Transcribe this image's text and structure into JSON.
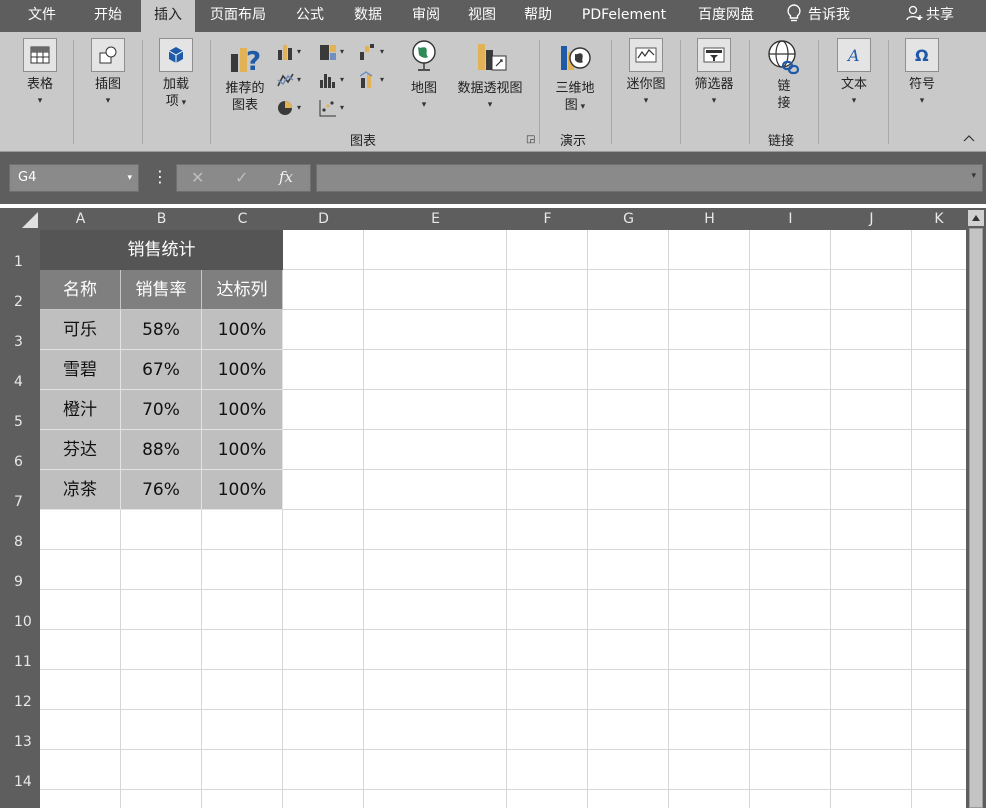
{
  "menubar": {
    "tabs": [
      "文件",
      "开始",
      "插入",
      "页面布局",
      "公式",
      "数据",
      "审阅",
      "视图",
      "帮助",
      "PDFelement",
      "百度网盘"
    ],
    "active_tab": "插入",
    "tell_me": "告诉我",
    "share": "共享"
  },
  "ribbon": {
    "table": "表格",
    "illustrations": "插图",
    "addins_line1": "加载",
    "addins_line2": "项",
    "recommended_line1": "推荐的",
    "recommended_line2": "图表",
    "maps": "地图",
    "pivotchart": "数据透视图",
    "map3d_line1": "三维地",
    "map3d_line2": "图",
    "sparklines": "迷你图",
    "filters": "筛选器",
    "link_line1": "链",
    "link_line2": "接",
    "text": "文本",
    "symbols": "符号",
    "group_charts": "图表",
    "group_tours": "演示",
    "group_links": "链接"
  },
  "formula_bar": {
    "name_box": "G4",
    "cancel_symbol": "✕",
    "enter_symbol": "✓",
    "fx_symbol": "fx",
    "content": ""
  },
  "sheet": {
    "columns": [
      "A",
      "B",
      "C",
      "D",
      "E",
      "F",
      "G",
      "H",
      "I",
      "J",
      "K"
    ],
    "rows": [
      "1",
      "2",
      "3",
      "4",
      "5",
      "6",
      "7",
      "8",
      "9",
      "10",
      "11",
      "12",
      "13",
      "14"
    ],
    "title": "销售统计",
    "headers": [
      "名称",
      "销售率",
      "达标列"
    ],
    "data": [
      [
        "可乐",
        "58%",
        "100%"
      ],
      [
        "雪碧",
        "67%",
        "100%"
      ],
      [
        "橙汁",
        "70%",
        "100%"
      ],
      [
        "芬达",
        "88%",
        "100%"
      ],
      [
        "凉茶",
        "76%",
        "100%"
      ]
    ]
  },
  "colors": {
    "dark_bg": "#5e5e5e",
    "ribbon_bg": "#c9c9c9",
    "title_fill": "#555555",
    "header_fill": "#7f7f7f",
    "data_fill": "#bfbfbf"
  }
}
